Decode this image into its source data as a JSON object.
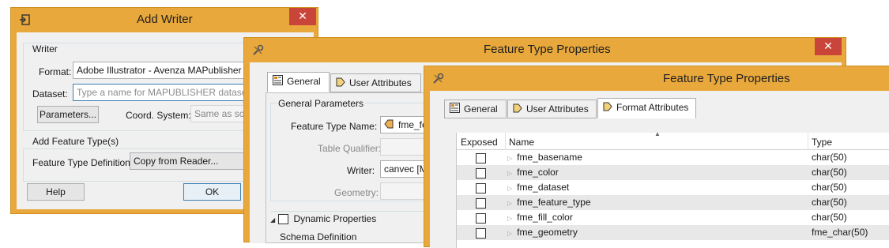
{
  "add_writer": {
    "title": "Add Writer",
    "close_label": "✕",
    "writer_group": "Writer",
    "format_label": "Format:",
    "format_value": "Adobe Illustrator - Avenza MAPublisher",
    "dataset_label": "Dataset:",
    "dataset_placeholder": "Type a name for MAPUBLISHER dataset",
    "parameters_button": "Parameters...",
    "coord_label": "Coord. System:",
    "coord_value": "Same as sour",
    "feature_types_group": "Add Feature Type(s)",
    "ftd_label": "Feature Type Definition:",
    "ftd_value": "Copy from Reader...",
    "help_button": "Help",
    "ok_button": "OK"
  },
  "ftp1": {
    "title": "Feature Type Properties",
    "close_label": "✕",
    "tabs": [
      "General",
      "User Attributes"
    ],
    "general_params": "General Parameters",
    "ft_name_label": "Feature Type Name:",
    "ft_name_value": "fme_fea",
    "table_qualifier_label": "Table Qualifier:",
    "writer_label": "Writer:",
    "writer_value": "canvec [MAF",
    "geometry_label": "Geometry:",
    "dynamic_props": "Dynamic Properties",
    "schema_def": "Schema Definition"
  },
  "ftp2": {
    "title": "Feature Type Properties",
    "tabs": [
      "General",
      "User Attributes",
      "Format Attributes"
    ],
    "columns": [
      "Exposed",
      "Name",
      "Type"
    ],
    "rows": [
      {
        "name": "fme_basename",
        "type": "char(50)"
      },
      {
        "name": "fme_color",
        "type": "char(50)"
      },
      {
        "name": "fme_dataset",
        "type": "char(50)"
      },
      {
        "name": "fme_feature_type",
        "type": "char(50)"
      },
      {
        "name": "fme_fill_color",
        "type": "char(50)"
      },
      {
        "name": "fme_geometry",
        "type": "fme_char(50)"
      }
    ]
  },
  "colors": {
    "titlebar": "#e9a83c",
    "close_button": "#c9453a",
    "client": "#f0f0f0",
    "row_alt": "#e8e8e8"
  }
}
